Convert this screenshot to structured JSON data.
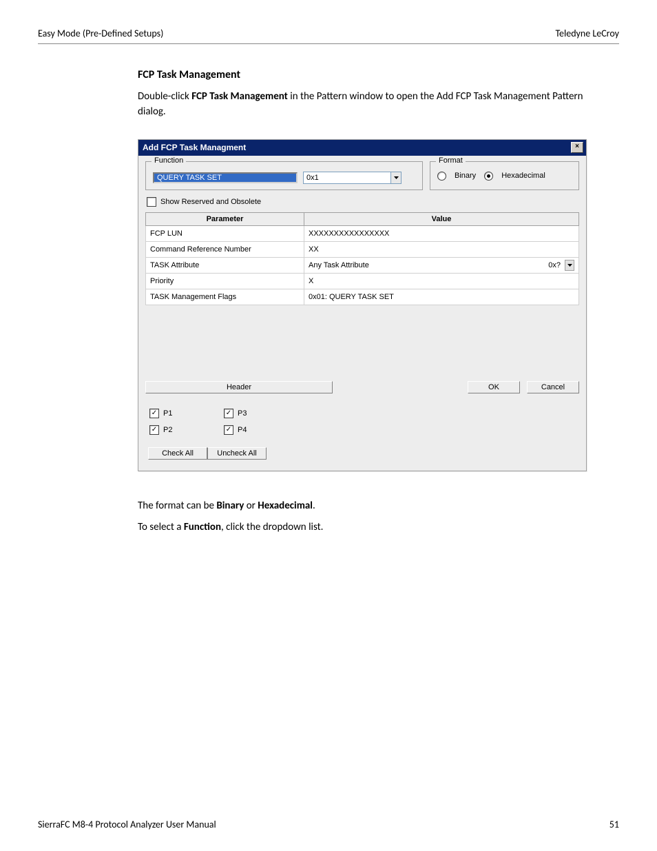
{
  "header": {
    "left": "Easy Mode (Pre-Defined Setups)",
    "right": "Teledyne  LeCroy"
  },
  "section_title": "FCP Task Management",
  "intro": {
    "pre": "Double-click ",
    "bold": "FCP Task Management",
    "post": " in the Pattern window to open the Add FCP Task Management Pattern dialog."
  },
  "dialog": {
    "title": "Add FCP Task Managment",
    "function": {
      "legend": "Function",
      "selected": "QUERY TASK SET",
      "code": "0x1"
    },
    "format": {
      "legend": "Format",
      "options": {
        "binary": "Binary",
        "hex": "Hexadecimal"
      },
      "selected": "hex"
    },
    "show_reserved_label": "Show Reserved and Obsolete",
    "table": {
      "headers": {
        "param": "Parameter",
        "value": "Value"
      },
      "rows": [
        {
          "param": "FCP LUN",
          "value": "XXXXXXXXXXXXXXXX"
        },
        {
          "param": "Command Reference Number",
          "value": "XX"
        },
        {
          "param": "TASK Attribute",
          "value": "Any Task Attribute",
          "extra": "0x?",
          "dropdown": true
        },
        {
          "param": "Priority",
          "value": "X"
        },
        {
          "param": "TASK Management Flags",
          "value": "0x01: QUERY TASK SET"
        }
      ]
    },
    "buttons": {
      "header": "Header",
      "ok": "OK",
      "cancel": "Cancel"
    },
    "ports": {
      "p1": "P1",
      "p2": "P2",
      "p3": "P3",
      "p4": "P4"
    },
    "check_all": "Check All",
    "uncheck_all": "Uncheck All"
  },
  "tail": {
    "line1": {
      "pre": "The format can be ",
      "b1": "Binary",
      "mid": " or ",
      "b2": "Hexadecimal",
      "post": "."
    },
    "line2": {
      "pre": "To select a ",
      "b1": "Function",
      "post": ", click the dropdown list."
    }
  },
  "footer": {
    "left": "SierraFC M8-4 Protocol Analyzer User Manual",
    "right": "51"
  }
}
